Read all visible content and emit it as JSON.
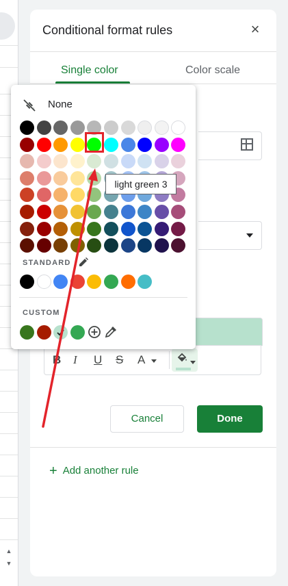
{
  "panel": {
    "title": "Conditional format rules",
    "tabs": [
      {
        "label": "Single color",
        "active": true
      },
      {
        "label": "Color scale",
        "active": false
      }
    ]
  },
  "buttons": {
    "cancel": "Cancel",
    "done": "Done",
    "add_rule": "Add another rule"
  },
  "preview": {
    "fill_color": "#b7e1cd"
  },
  "toolbar": {
    "items": [
      "bold-icon",
      "italic-icon",
      "underline-icon",
      "strikethrough-icon",
      "text-color-icon",
      "fill-color-icon"
    ],
    "bold": "B",
    "italic": "I",
    "underline": "U",
    "strike": "S",
    "textcolor": "A"
  },
  "color_picker": {
    "none_label": "None",
    "standard_label": "STANDARD",
    "custom_label": "CUSTOM",
    "tooltip": "light green 3",
    "palette": [
      [
        "#000000",
        "#434343",
        "#666666",
        "#999999",
        "#b7b7b7",
        "#cccccc",
        "#d9d9d9",
        "#efefef",
        "#f3f3f3",
        "#ffffff"
      ],
      [
        "#980000",
        "#ff0000",
        "#ff9900",
        "#ffff00",
        "#00ff00",
        "#00ffff",
        "#4a86e8",
        "#0000ff",
        "#9900ff",
        "#ff00ff"
      ],
      [
        "#e6b8af",
        "#f4cccc",
        "#fce5cd",
        "#fff2cc",
        "#d9ead3",
        "#d0e0e3",
        "#c9daf8",
        "#cfe2f3",
        "#d9d2e9",
        "#ead1dc"
      ],
      [
        "#dd7e6b",
        "#ea9999",
        "#f9cb9c",
        "#ffe599",
        "#b6d7a8",
        "#a2c4c9",
        "#a4c2f4",
        "#9fc5e8",
        "#b4a7d6",
        "#d5a6bd"
      ],
      [
        "#cc4125",
        "#e06666",
        "#f6b26b",
        "#ffd966",
        "#93c47d",
        "#76a5af",
        "#6d9eeb",
        "#6fa8dc",
        "#8e7cc3",
        "#c27ba0"
      ],
      [
        "#a61c00",
        "#cc0000",
        "#e69138",
        "#f1c232",
        "#6aa84f",
        "#45818e",
        "#3c78d8",
        "#3d85c6",
        "#674ea7",
        "#a64d79"
      ],
      [
        "#85200c",
        "#990000",
        "#b45f06",
        "#bf9000",
        "#38761d",
        "#134f5c",
        "#1155cc",
        "#0b5394",
        "#351c75",
        "#741b47"
      ],
      [
        "#5b0f00",
        "#660000",
        "#783f04",
        "#7f6000",
        "#274e13",
        "#0c343d",
        "#1c4587",
        "#073763",
        "#20124d",
        "#4c1130"
      ]
    ],
    "standard": [
      "#000000",
      "#ffffff",
      "#4285f4",
      "#ea4335",
      "#fbbc04",
      "#34a853",
      "#ff6d01",
      "#46bdc6"
    ],
    "custom": [
      "#38761d",
      "#a61c00",
      "#b7e1cd",
      "#34a853"
    ],
    "selected_custom": "#b7e1cd"
  },
  "annotation": {
    "highlight_color": "#e3242b",
    "arrow_color": "#e3242b"
  },
  "colors": {
    "accent": "#188038"
  }
}
